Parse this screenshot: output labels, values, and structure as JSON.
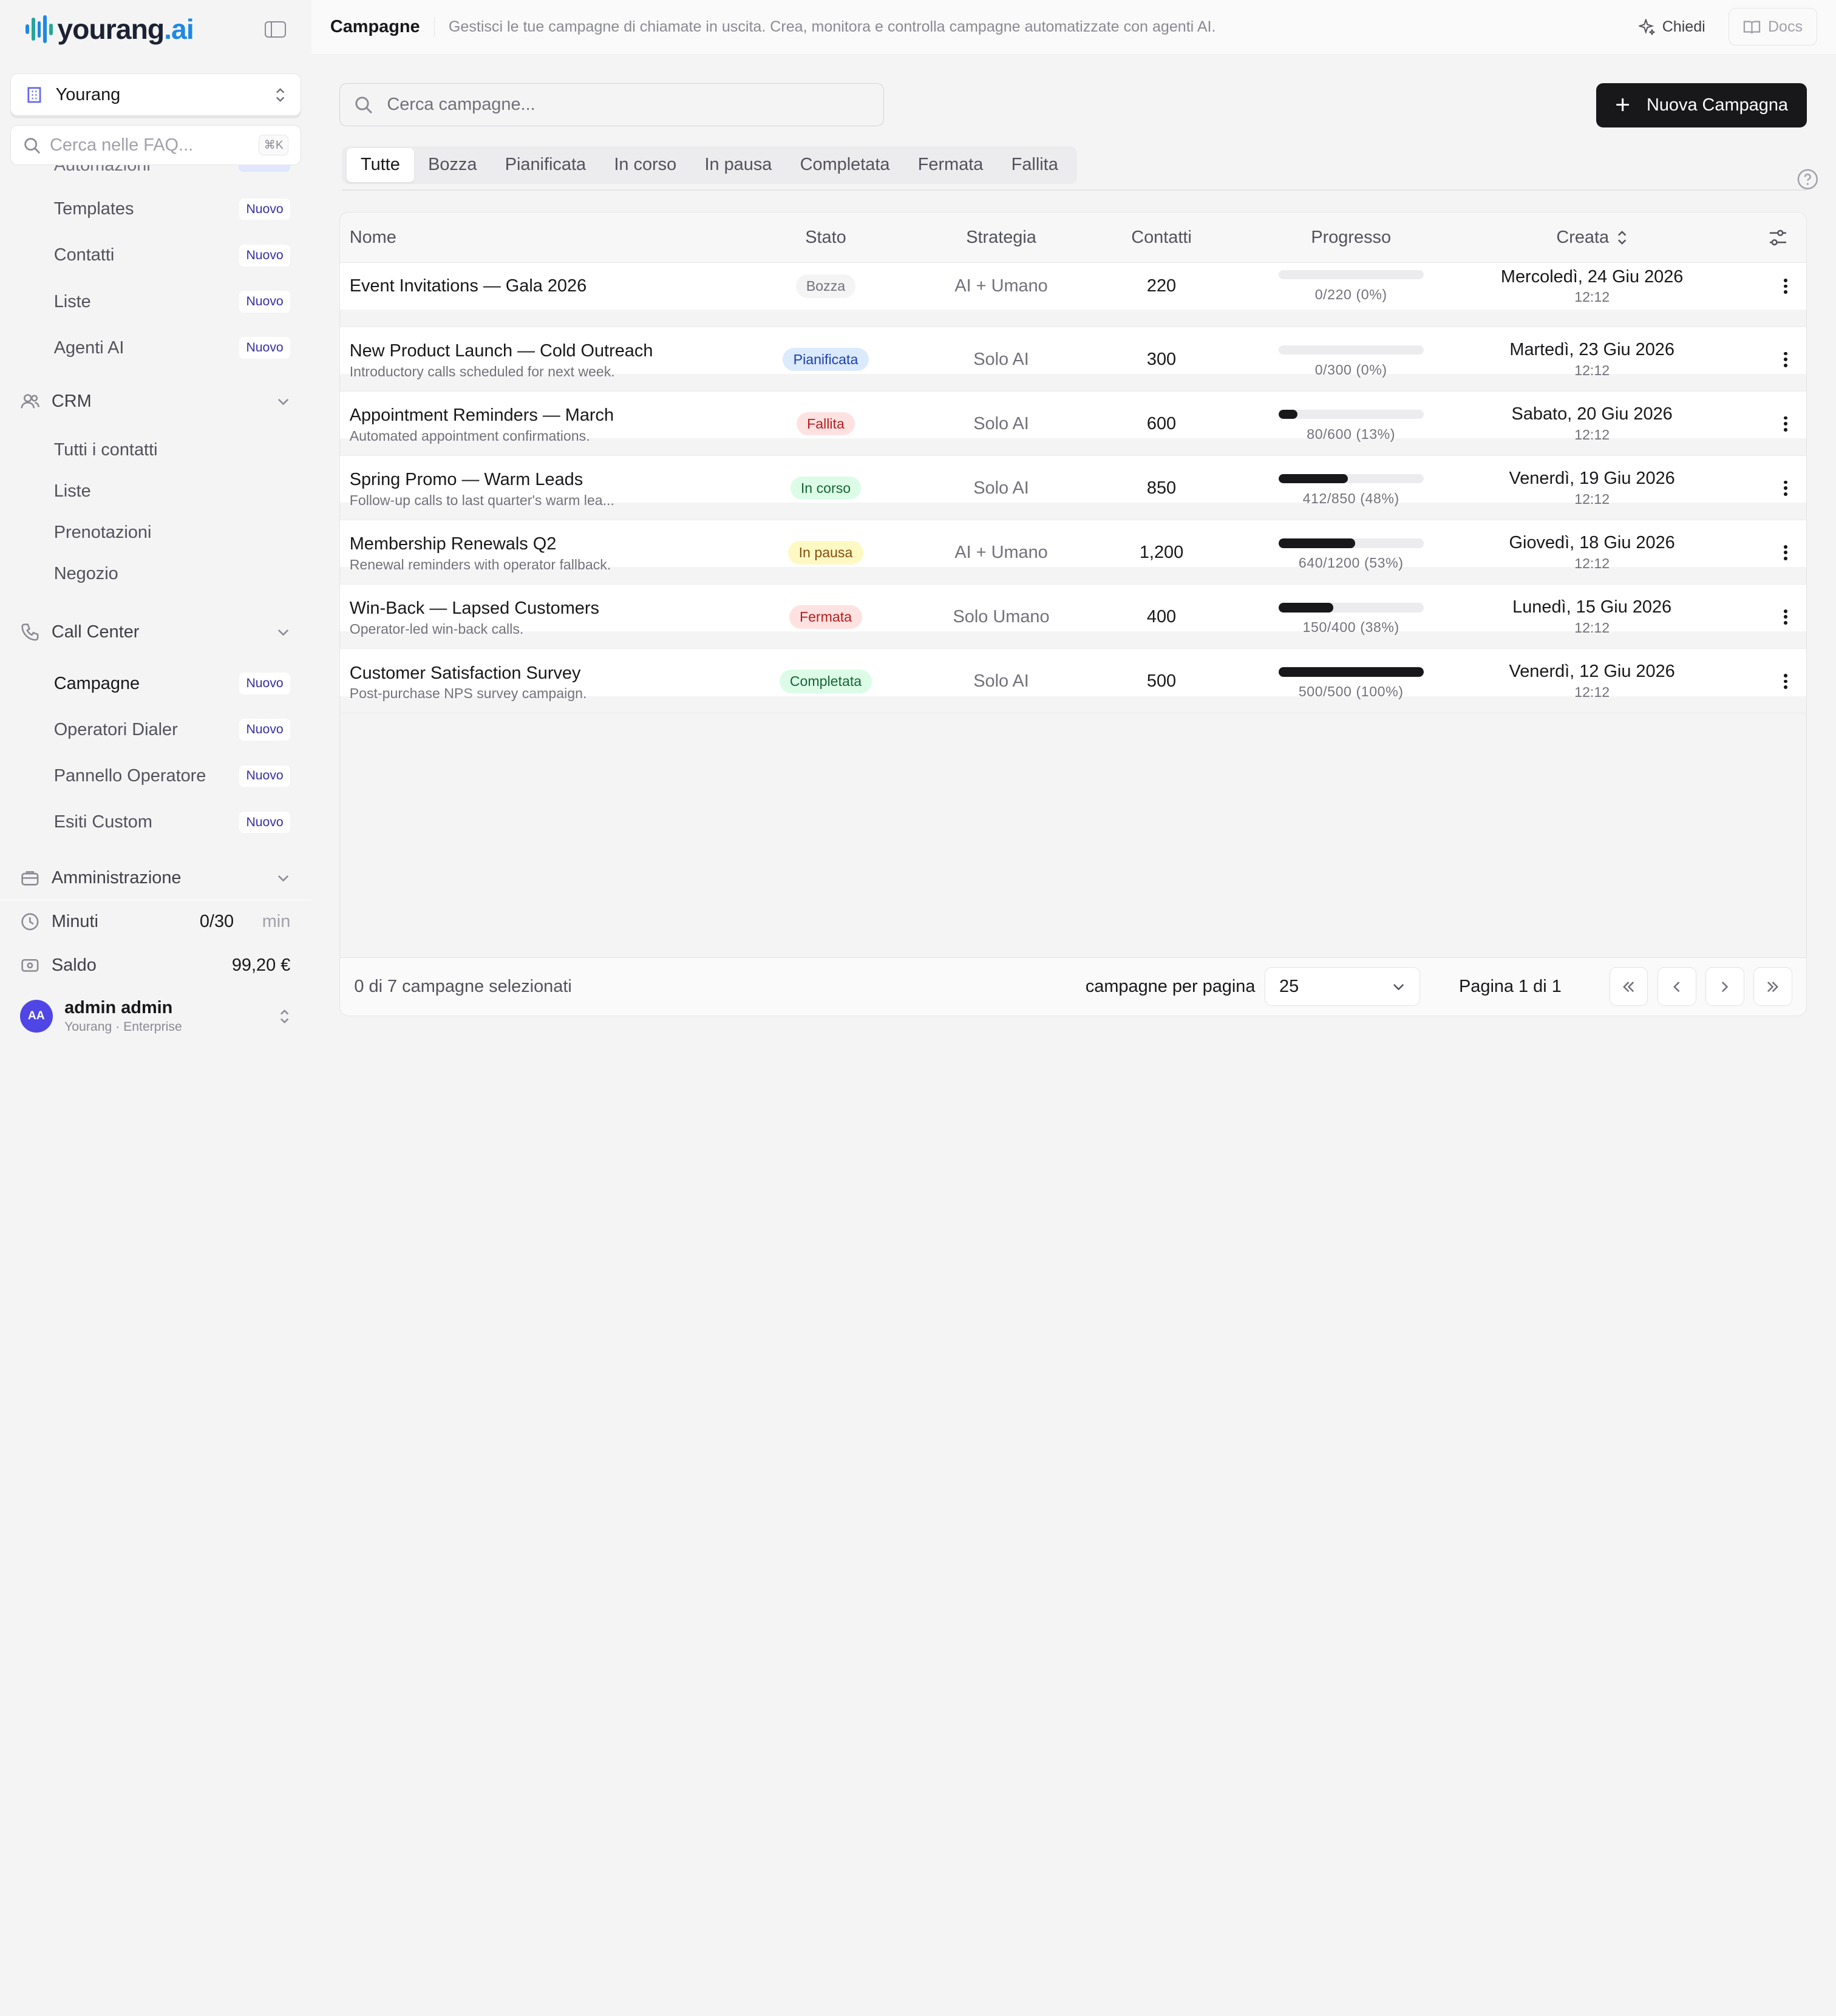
{
  "brand": {
    "name": "yourang",
    "suffix": ".ai"
  },
  "org": {
    "label": "Yourang"
  },
  "faq_search": {
    "placeholder": "Cerca nelle FAQ...",
    "shortcut": "⌘K"
  },
  "sidebar": {
    "cutoff_item": "Automazioni",
    "top_items": [
      {
        "label": "Templates",
        "badge": "Nuovo"
      },
      {
        "label": "Contatti",
        "badge": "Nuovo"
      },
      {
        "label": "Liste",
        "badge": "Nuovo"
      },
      {
        "label": "Agenti AI",
        "badge": "Nuovo"
      }
    ],
    "crm": {
      "title": "CRM",
      "items": [
        "Tutti i contatti",
        "Liste",
        "Prenotazioni",
        "Negozio"
      ]
    },
    "callcenter": {
      "title": "Call Center",
      "items": [
        {
          "label": "Campagne",
          "badge": "Nuovo"
        },
        {
          "label": "Operatori Dialer",
          "badge": "Nuovo"
        },
        {
          "label": "Pannello Operatore",
          "badge": "Nuovo"
        },
        {
          "label": "Esiti Custom",
          "badge": "Nuovo"
        }
      ]
    },
    "admin": {
      "title": "Amministrazione"
    }
  },
  "footer": {
    "minutes": {
      "label": "Minuti",
      "value": "0/30",
      "unit": "min"
    },
    "balance": {
      "label": "Saldo",
      "value": "99,20 €"
    },
    "user": {
      "initials": "AA",
      "name": "admin admin",
      "sub": "Yourang · Enterprise"
    }
  },
  "topbar": {
    "title": "Campagne",
    "description": "Gestisci le tue campagne di chiamate in uscita. Crea, monitora e controlla campagne automatizzate con agenti AI.",
    "ask": "Chiedi",
    "docs": "Docs"
  },
  "search": {
    "placeholder": "Cerca campagne..."
  },
  "new_button": "Nuova Campagna",
  "tabs": [
    "Tutte",
    "Bozza",
    "Pianificata",
    "In corso",
    "In pausa",
    "Completata",
    "Fermata",
    "Fallita"
  ],
  "columns": {
    "name": "Nome",
    "status": "Stato",
    "strategy": "Strategia",
    "contacts": "Contatti",
    "progress": "Progresso",
    "created": "Creata"
  },
  "rows": [
    {
      "name": "Event Invitations — Gala 2026",
      "sub": "",
      "status": "Bozza",
      "status_bg": "#f4f4f5",
      "status_fg": "#71717a",
      "strategy": "AI + Umano",
      "contacts": "220",
      "progress": 0,
      "progress_text": "0/220 (0%)",
      "date": "Mercoledì, 24 Giu 2026",
      "time": "12:12"
    },
    {
      "name": "New Product Launch — Cold Outreach",
      "sub": "Introductory calls scheduled for next week.",
      "status": "Pianificata",
      "status_bg": "#dbeafe",
      "status_fg": "#1e40af",
      "strategy": "Solo AI",
      "contacts": "300",
      "progress": 0,
      "progress_text": "0/300 (0%)",
      "date": "Martedì, 23 Giu 2026",
      "time": "12:12"
    },
    {
      "name": "Appointment Reminders — March",
      "sub": "Automated appointment confirmations.",
      "status": "Fallita",
      "status_bg": "#fee2e2",
      "status_fg": "#b91c1c",
      "strategy": "Solo AI",
      "contacts": "600",
      "progress": 13,
      "progress_text": "80/600 (13%)",
      "date": "Sabato, 20 Giu 2026",
      "time": "12:12"
    },
    {
      "name": "Spring Promo — Warm Leads",
      "sub": "Follow-up calls to last quarter's warm lea...",
      "status": "In corso",
      "status_bg": "#dcfce7",
      "status_fg": "#166534",
      "strategy": "Solo AI",
      "contacts": "850",
      "progress": 48,
      "progress_text": "412/850 (48%)",
      "date": "Venerdì, 19 Giu 2026",
      "time": "12:12"
    },
    {
      "name": "Membership Renewals Q2",
      "sub": "Renewal reminders with operator fallback.",
      "status": "In pausa",
      "status_bg": "#fef9c3",
      "status_fg": "#854d0e",
      "strategy": "AI + Umano",
      "contacts": "1,200",
      "progress": 53,
      "progress_text": "640/1200 (53%)",
      "date": "Giovedì, 18 Giu 2026",
      "time": "12:12"
    },
    {
      "name": "Win-Back — Lapsed Customers",
      "sub": "Operator-led win-back calls.",
      "status": "Fermata",
      "status_bg": "#fee2e2",
      "status_fg": "#b91c1c",
      "strategy": "Solo Umano",
      "contacts": "400",
      "progress": 38,
      "progress_text": "150/400 (38%)",
      "date": "Lunedì, 15 Giu 2026",
      "time": "12:12"
    },
    {
      "name": "Customer Satisfaction Survey",
      "sub": "Post-purchase NPS survey campaign.",
      "status": "Completata",
      "status_bg": "#dcfce7",
      "status_fg": "#166534",
      "strategy": "Solo AI",
      "contacts": "500",
      "progress": 100,
      "progress_text": "500/500 (100%)",
      "date": "Venerdì, 12 Giu 2026",
      "time": "12:12"
    }
  ],
  "table_footer": {
    "selection": "0 di 7 campagne selezionati",
    "per_page_label": "campagne per pagina",
    "per_page_value": "25",
    "page_label": "Pagina 1 di 1"
  }
}
